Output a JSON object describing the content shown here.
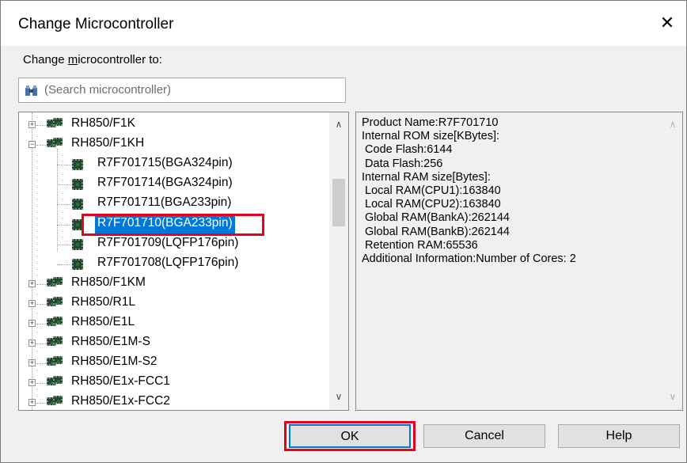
{
  "window": {
    "title": "Change Microcontroller",
    "close_glyph": "✕"
  },
  "label": {
    "prefix": "Change ",
    "mnemonic": "m",
    "suffix": "icrocontroller to:"
  },
  "search": {
    "placeholder": "(Search microcontroller)",
    "icon": "binoculars-icon"
  },
  "tree": {
    "groups_top": [
      {
        "label": "RH850/F1K",
        "expanded": false
      },
      {
        "label": "RH850/F1KH",
        "expanded": true
      }
    ],
    "children": [
      {
        "label": "R7F701715(BGA324pin)",
        "selected": false
      },
      {
        "label": "R7F701714(BGA324pin)",
        "selected": false
      },
      {
        "label": "R7F701711(BGA233pin)",
        "selected": false
      },
      {
        "label": "R7F701710(BGA233pin)",
        "selected": true
      },
      {
        "label": "R7F701709(LQFP176pin)",
        "selected": false
      },
      {
        "label": "R7F701708(LQFP176pin)",
        "selected": false
      }
    ],
    "groups_bottom": [
      {
        "label": "RH850/F1KM"
      },
      {
        "label": "RH850/R1L"
      },
      {
        "label": "RH850/E1L"
      },
      {
        "label": "RH850/E1M-S"
      },
      {
        "label": "RH850/E1M-S2"
      },
      {
        "label": "RH850/E1x-FCC1"
      },
      {
        "label": "RH850/E1x-FCC2"
      }
    ],
    "highlight_color": "#e8001c"
  },
  "info": {
    "lines": [
      "Product Name:R7F701710",
      "Internal ROM size[KBytes]:",
      " Code Flash:6144",
      " Data Flash:256",
      "Internal RAM size[Bytes]:",
      " Local RAM(CPU1):163840",
      " Local RAM(CPU2):163840",
      " Global RAM(BankA):262144",
      " Global RAM(BankB):262144",
      " Retention RAM:65536",
      "Additional Information:Number of Cores: 2"
    ]
  },
  "buttons": {
    "ok": "OK",
    "cancel": "Cancel",
    "help": "Help"
  },
  "colors": {
    "selection": "#0078d7",
    "annotation": "#e8001c"
  }
}
